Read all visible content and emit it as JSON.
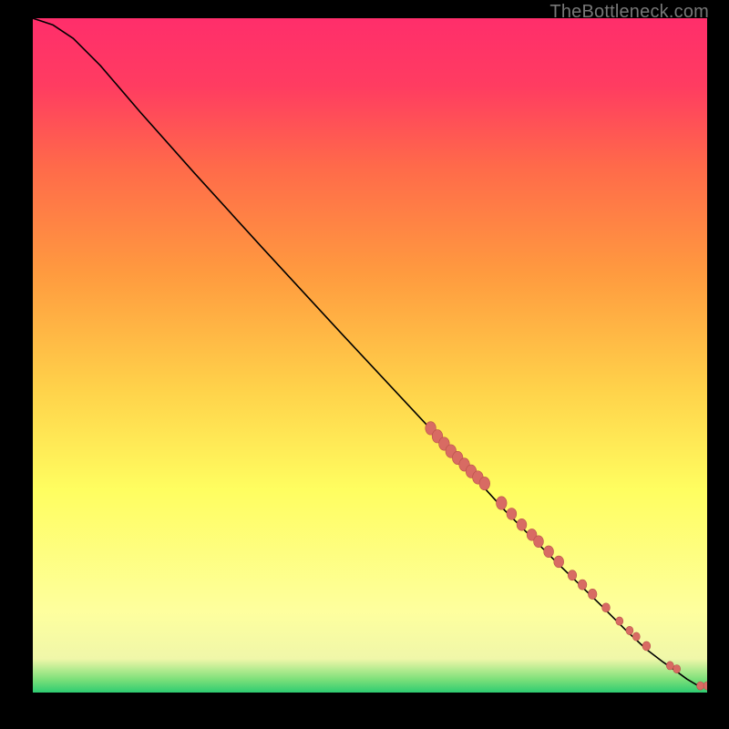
{
  "attribution": "TheBottleneck.com",
  "colors": {
    "curve": "#000000",
    "dot_fill": "#d86b63",
    "dot_stroke": "#b84f49",
    "green": "#2ecc71",
    "yellow": "#fff04a",
    "red": "#ff2e6b"
  },
  "chart_data": {
    "type": "line",
    "title": "",
    "xlabel": "",
    "ylabel": "",
    "xlim": [
      0,
      100
    ],
    "ylim": [
      0,
      100
    ],
    "curve": {
      "x": [
        0,
        3,
        6,
        10,
        16,
        24,
        34,
        46,
        60,
        70,
        78,
        84,
        88,
        91,
        93.5,
        95.5,
        97,
        98.5,
        100
      ],
      "y": [
        100,
        99,
        97,
        93,
        86,
        77,
        66,
        53,
        38,
        27,
        19,
        13.2,
        9.2,
        6.4,
        4.5,
        3.1,
        2.0,
        1.1,
        1.0
      ]
    },
    "dots": {
      "x": [
        59,
        60,
        61,
        62,
        63,
        64,
        65,
        66,
        67,
        69.5,
        71,
        72.5,
        74,
        75,
        76.5,
        78,
        80,
        81.5,
        83,
        85,
        87,
        88.5,
        89.5,
        91,
        94.5,
        95.5,
        99,
        100
      ],
      "y": [
        39.2,
        38.0,
        36.9,
        35.8,
        34.8,
        33.8,
        32.8,
        31.9,
        31.0,
        28.1,
        26.5,
        24.9,
        23.4,
        22.4,
        20.9,
        19.4,
        17.4,
        16.0,
        14.6,
        12.6,
        10.6,
        9.2,
        8.3,
        6.9,
        4.0,
        3.5,
        1.0,
        1.0
      ],
      "rx": [
        5.8,
        5.8,
        5.8,
        5.8,
        5.8,
        5.8,
        5.8,
        5.8,
        5.8,
        5.8,
        5.4,
        5.4,
        5.4,
        5.4,
        5.4,
        5.4,
        4.8,
        4.8,
        4.8,
        4.4,
        4.0,
        4.0,
        4.0,
        4.4,
        4.0,
        4.0,
        4.0,
        4.0
      ],
      "ry": [
        7.2,
        7.2,
        7.2,
        7.2,
        7.2,
        7.2,
        7.2,
        7.2,
        7.2,
        7.2,
        6.4,
        6.4,
        6.4,
        6.4,
        6.4,
        6.4,
        5.6,
        5.6,
        5.6,
        5.0,
        4.6,
        4.6,
        4.6,
        5.0,
        4.6,
        4.6,
        4.6,
        4.6
      ]
    }
  }
}
